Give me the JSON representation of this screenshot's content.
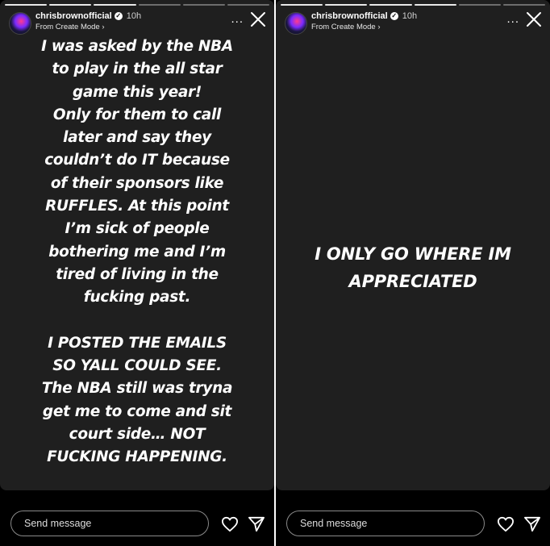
{
  "stories": [
    {
      "username": "chrisbrownofficial",
      "time": "10h",
      "subtitle": "From Create Mode",
      "more_label": "...",
      "text": "I was asked by the NBA\nto play in the all star\ngame this year!\nOnly for them to call\nlater and say they\ncouldn’t do  IT because\nof their sponsors like\nRUFFLES. At this point\nI’m sick of people\nbothering me and I’m\ntired of living in the\nfucking past.\n\nI POSTED THE EMAILS\nSO YALL COULD SEE.\nThe NBA still was tryna\nget me to come and sit\ncourt side… NOT\nFUCKING HAPPENING.",
      "message_placeholder": "Send message"
    },
    {
      "username": "chrisbrownofficial",
      "time": "10h",
      "subtitle": "From Create Mode",
      "more_label": "...",
      "text": "I ONLY GO WHERE IM\nAPPRECIATED",
      "message_placeholder": "Send message"
    }
  ]
}
